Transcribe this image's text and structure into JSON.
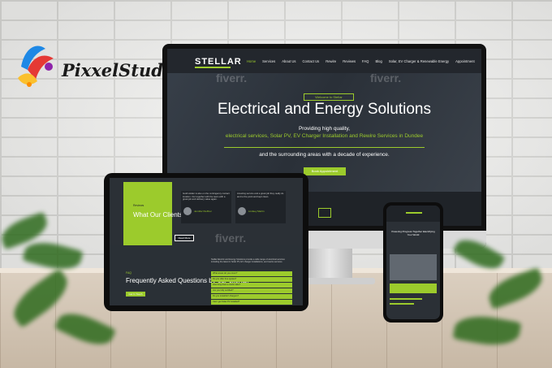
{
  "logo": {
    "text": "PixxelStudio",
    "colors": [
      "#1e88e5",
      "#e53935",
      "#fbc02d",
      "#8e24aa"
    ]
  },
  "colors": {
    "accent": "#9ccb2c",
    "dark": "#23272d"
  },
  "watermark": "fiverr.",
  "monitor": {
    "brand": "STELLAR",
    "nav": [
      "Home",
      "Services",
      "About Us",
      "Contact Us",
      "Rewire",
      "Reviews",
      "FAQ",
      "Blog",
      "Solar, EV Charger & Renewable Energy",
      "Appointment"
    ],
    "hero": {
      "kicker": "Welcome to Stellar",
      "title": "Electrical and Energy Solutions",
      "line1": "Providing high quality,",
      "line2": "electrical services, Solar PV, EV Charger Installation and Rewire Services in Dundee",
      "line3": "and the surrounding areas with a decade of experience.",
      "button": "Book Appointment"
    }
  },
  "tablet": {
    "testimonials": {
      "kicker": "Reviews",
      "title": "What Our Clients Say",
      "button": "Read More",
      "reviews": [
        {
          "name": "Jennifer Kleffner",
          "text": "Gold Holder is also on the contingency contact location. Our together with the team with a great job and delivery value again."
        },
        {
          "name": "Lindsey Martin",
          "text": "Amazing service and a great job they really do and to the point and kept clean."
        }
      ]
    },
    "faq": {
      "kicker": "FAQ",
      "title": "Frequently Asked Questions by our clients.",
      "button": "Get In Touch",
      "intro": "Stellar Electric and Energy Solutions provide a wide range of electrical services including the latest in Solar PV, EV charger installations, and rewire services.",
      "items": [
        "What areas do you cover?",
        "Do you offer free quotes?",
        "How long does a rewire take?",
        "Are you fully certified?",
        "Do you install EV chargers?",
        "Can I get Solar PV installed?"
      ]
    }
  },
  "phone": {
    "hero_title": "Powering Progress Together Electrifying Your World"
  }
}
